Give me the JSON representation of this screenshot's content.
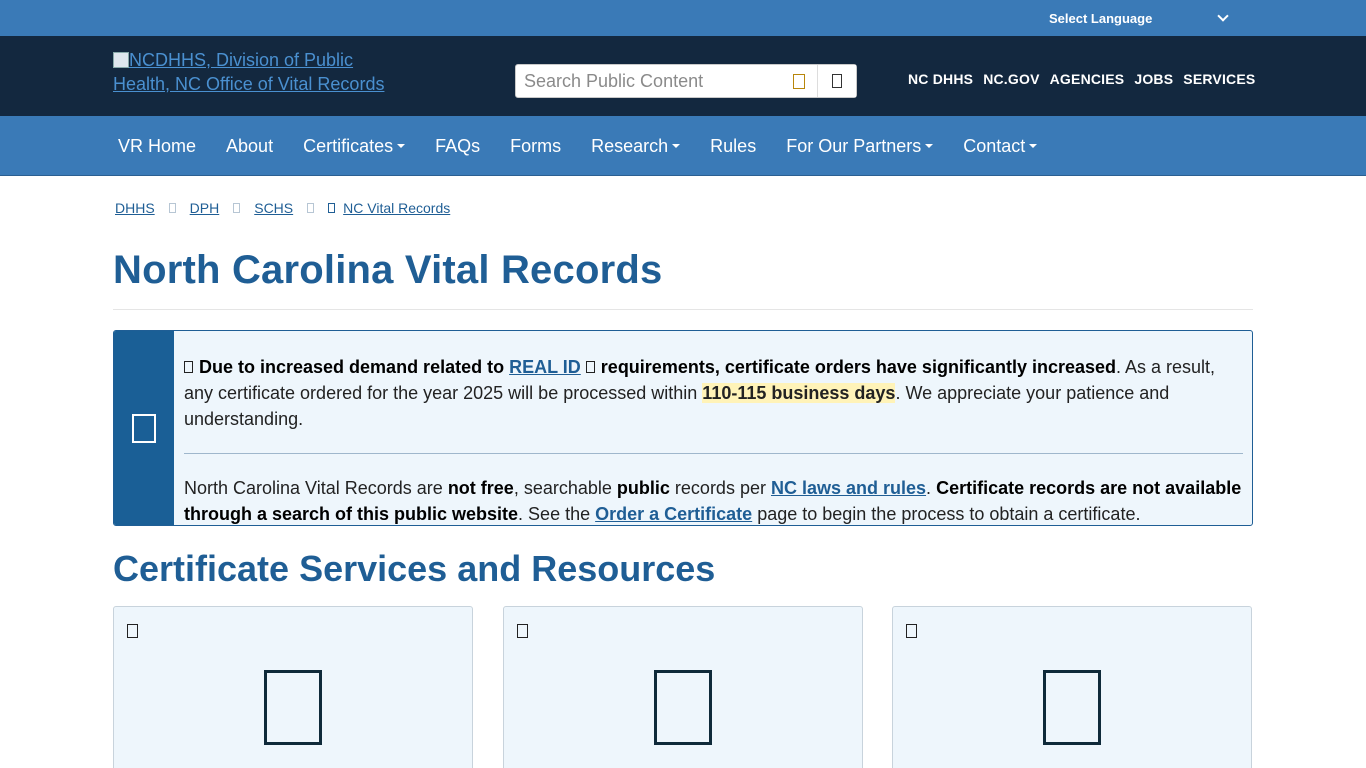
{
  "language": {
    "label": "Select Language"
  },
  "header": {
    "logo_alt": "NCDHHS, Division of Public Health, NC Office of Vital Records",
    "search_placeholder": "Search Public Content",
    "util_links": [
      "NC DHHS",
      "NC.GOV",
      "AGENCIES",
      "JOBS",
      "SERVICES"
    ]
  },
  "nav": {
    "items": [
      {
        "label": "VR Home",
        "dropdown": false
      },
      {
        "label": "About",
        "dropdown": false
      },
      {
        "label": "Certificates",
        "dropdown": true
      },
      {
        "label": "FAQs",
        "dropdown": false
      },
      {
        "label": "Forms",
        "dropdown": false
      },
      {
        "label": "Research",
        "dropdown": true
      },
      {
        "label": "Rules",
        "dropdown": false
      },
      {
        "label": "For Our Partners",
        "dropdown": true
      },
      {
        "label": "Contact",
        "dropdown": true
      }
    ]
  },
  "breadcrumb": [
    "DHHS",
    "DPH",
    "SCHS",
    "NC Vital Records"
  ],
  "page": {
    "title": "North Carolina Vital Records",
    "section_title": "Certificate Services and Resources"
  },
  "alert": {
    "p1_bold_a": "Due to increased demand related to",
    "p1_link": "REAL ID",
    "p1_bold_b": "requirements, certificate orders have significantly increased",
    "p1_text_a": ". As a result, any certificate ordered for the year 2025 will be processed within",
    "p1_highlight": "110-115 business days",
    "p1_text_b": ". We appreciate your patience and understanding.",
    "p2_text_a": "North Carolina Vital Records are",
    "p2_bold_a": "not free",
    "p2_text_b": ", searchable",
    "p2_bold_b": "public",
    "p2_text_c": "records per",
    "p2_link_a": "NC laws and rules",
    "p2_text_d": ".",
    "p2_bold_c": "Certificate records are not available through a search of this public website",
    "p2_text_e": ". See the",
    "p2_link_b": "Order a Certificate",
    "p2_text_f": "page to begin the process to obtain a certificate."
  },
  "icons": {
    "search": "search-icon",
    "alert": "info-icon",
    "card_small": "document-icon",
    "card_big": "certificate-icon"
  }
}
